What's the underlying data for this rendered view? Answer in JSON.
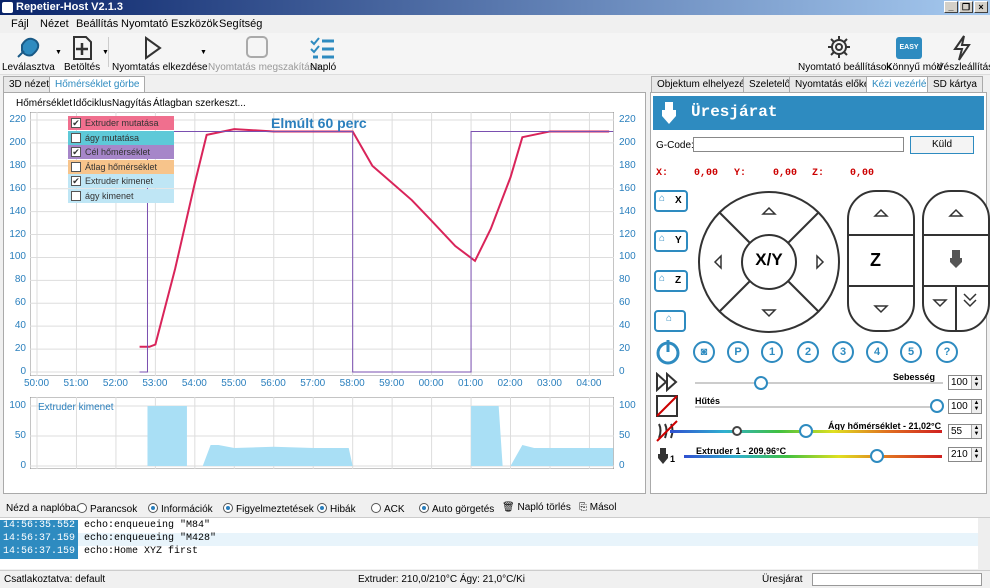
{
  "app": {
    "title": "Repetier-Host V2.1.3"
  },
  "menu": [
    "Fájl",
    "Nézet",
    "Beállítás",
    "Nyomtató",
    "Eszközök",
    "Segítség"
  ],
  "toolbar": {
    "disconnect": "Leválasztva",
    "load": "Betöltés",
    "start_print": "Nyomtatás elkezdése",
    "stop_print": "Nyomtatás megszakítása",
    "log": "Napló",
    "printer_settings": "Nyomtató beállítások",
    "easy_mode": "Könnyű mód",
    "easy_badge": "EASY",
    "emergency": "Vészleállítás"
  },
  "left_tabs": [
    "3D nézet",
    "Hőmérséklet görbe"
  ],
  "right_tabs": [
    "Objektum elhelyezése",
    "Szeletelő",
    "Nyomtatás előkép",
    "Kézi vezérlés",
    "SD kártya"
  ],
  "chart_menu": [
    "Hőmérséklet",
    "Időciklus",
    "Nagyítás",
    "Átlagban szerkeszt..."
  ],
  "legend": [
    {
      "label": "Extruder mutatása",
      "checked": true,
      "color": "#f06f8e"
    },
    {
      "label": "ágy mutatása",
      "checked": false,
      "color": "#5ec9d8"
    },
    {
      "label": "Cél hőmérséklet",
      "checked": true,
      "color": "#a686c9"
    },
    {
      "label": "Átlag hőmérséklet",
      "checked": false,
      "color": "#f7c48b"
    },
    {
      "label": "Extruder kimenet",
      "checked": true,
      "color": "#bfe6f5"
    },
    {
      "label": "ágy kimenet",
      "checked": false,
      "color": "#bfe6f5"
    }
  ],
  "chart_data": [
    {
      "type": "line",
      "title": "Elmúlt 60 perc",
      "ylim": [
        0,
        220
      ],
      "yticks": [
        220,
        200,
        180,
        160,
        140,
        120,
        100,
        80,
        60,
        40,
        20,
        0
      ],
      "xticks": [
        "50:00",
        "51:00",
        "52:00",
        "53:00",
        "54:00",
        "55:00",
        "56:00",
        "57:00",
        "58:00",
        "59:00",
        "00:00",
        "01:00",
        "02:00",
        "03:00",
        "04:00"
      ],
      "series": [
        {
          "name": "Extruder",
          "color": "#d9245a",
          "x": [
            52.6,
            52.85,
            53.0,
            53.5,
            54.0,
            54.3,
            55.0,
            56.0,
            57.0,
            58.0,
            58.5,
            59.5,
            60.0,
            60.6,
            61.1,
            61.5,
            62.0,
            62.3,
            63.0,
            64.0,
            64.5
          ],
          "y": [
            22,
            22,
            24,
            90,
            165,
            207,
            212,
            210,
            210,
            210,
            180,
            150,
            132,
            110,
            97,
            125,
            170,
            205,
            210,
            210,
            210
          ]
        },
        {
          "name": "Cél",
          "color": "#7a4fb0",
          "x": [
            52.6,
            52.8,
            52.8,
            58.0,
            58.0,
            61.0,
            61.0,
            64.6
          ],
          "y": [
            0,
            0,
            210,
            210,
            0,
            0,
            210,
            210
          ]
        }
      ]
    },
    {
      "type": "area",
      "title": "Extruder kimenet",
      "ylim": [
        0,
        100
      ],
      "yticks": [
        100,
        50,
        0
      ],
      "series": [
        {
          "name": "Extruder kimenet",
          "color": "#a9dff5",
          "x": [
            52.8,
            52.8,
            53.8,
            53.8,
            54.2,
            54.4,
            54.6,
            55.0,
            56.0,
            57.0,
            57.9,
            58.0,
            61.0,
            61.0,
            61.7,
            61.8,
            62.0,
            62.3,
            62.6,
            64.6
          ],
          "y": [
            0,
            100,
            100,
            0,
            0,
            35,
            35,
            30,
            32,
            30,
            30,
            0,
            0,
            100,
            100,
            0,
            0,
            35,
            30,
            30
          ]
        }
      ]
    }
  ],
  "manual": {
    "header": "Üresjárat",
    "gcode_label": "G-Code:",
    "gcode_value": "",
    "send": "Küld",
    "coords": {
      "x_label": "X:",
      "x": "0,00",
      "y_label": "Y:",
      "y": "0,00",
      "z_label": "Z:",
      "z": "0,00"
    },
    "home_x": "X",
    "home_y": "Y",
    "home_z": "Z",
    "xy": "X/Y",
    "z": "Z",
    "buttons": [
      "P",
      "1",
      "2",
      "3",
      "4",
      "5",
      "?"
    ],
    "speed_label": "Sebesség",
    "speed": "100",
    "fan_label": "Hűtés",
    "fan": "100",
    "bed_label": "Ágy hőmérséklet - 21,02°C",
    "bed": "55",
    "extruder_label": "Extruder 1 - 209,96°C",
    "extruder": "210",
    "extruder_num": "1"
  },
  "logbar": {
    "label": "Nézd a naplóba:",
    "commands": "Parancsok",
    "info": "Információk",
    "warnings": "Figyelmeztetések",
    "errors": "Hibák",
    "ack": "ACK",
    "autoscroll": "Auto görgetés",
    "clear": "Napló törlés",
    "copy": "Másol"
  },
  "log": [
    {
      "time": "14:56:35.552",
      "msg": "echo:enqueueing \"M84\""
    },
    {
      "time": "14:56:37.159",
      "msg": "echo:enqueueing \"M428\""
    },
    {
      "time": "14:56:37.159",
      "msg": "echo:Home XYZ first"
    }
  ],
  "status": {
    "connection": "Csatlakoztatva: default",
    "temps": "Extruder: 210,0/210°C Ágy: 21,0°C/Ki",
    "state": "Üresjárat"
  }
}
